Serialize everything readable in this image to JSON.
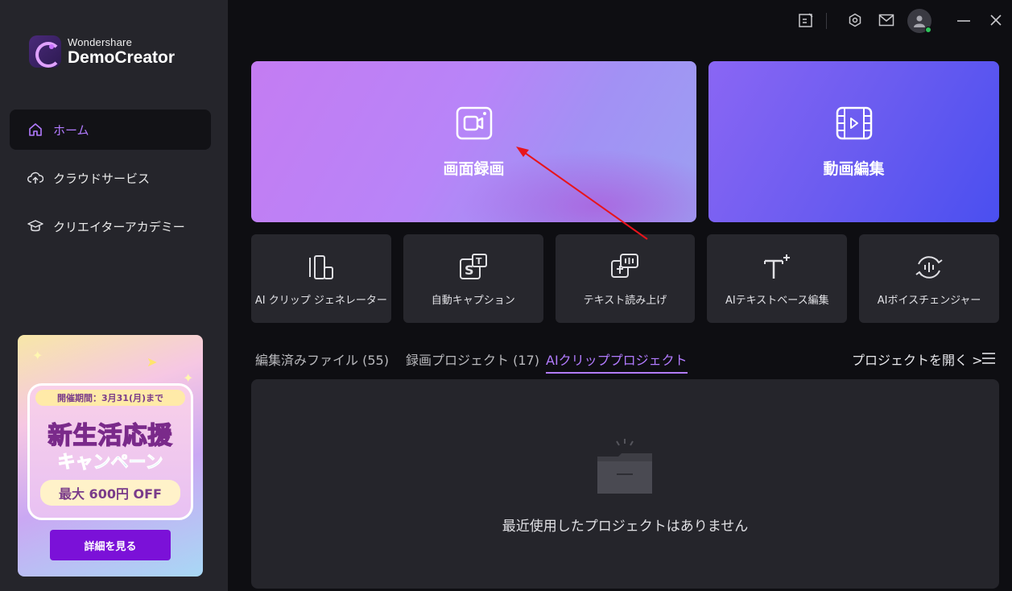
{
  "app": {
    "brand_sub": "Wondershare",
    "brand_main": "DemoCreator"
  },
  "sidebar": {
    "items": [
      {
        "label": "ホーム",
        "icon": "home-icon",
        "active": true
      },
      {
        "label": "クラウドサービス",
        "icon": "cloud-upload-icon",
        "active": false
      },
      {
        "label": "クリエイターアカデミー",
        "icon": "graduation-cap-icon",
        "active": false
      }
    ]
  },
  "promo": {
    "period": "開催期間：3月31(月)まで",
    "title": "新生活応援",
    "subtitle": "キャンペーン",
    "discount": "最大 600円 OFF",
    "button_label": "詳細を見る"
  },
  "topbar": {
    "icons": [
      "feedback-icon",
      "settings-hex-icon",
      "mail-icon",
      "user-avatar-icon",
      "minimize-icon",
      "close-icon"
    ]
  },
  "main": {
    "card_record_label": "画面録画",
    "card_edit_label": "動画編集",
    "tools": [
      {
        "label": "AI クリップ ジェネレーター",
        "icon": "ai-clip-icon"
      },
      {
        "label": "自動キャプション",
        "icon": "subtitle-icon"
      },
      {
        "label": "テキスト読み上げ",
        "icon": "text-to-speech-icon"
      },
      {
        "label": "AIテキストベース編集",
        "icon": "text-edit-icon"
      },
      {
        "label": "AIボイスチェンジャー",
        "icon": "voice-changer-icon"
      }
    ],
    "tabs": [
      {
        "label": "編集済みファイル (55)",
        "active": false
      },
      {
        "label": "録画プロジェクト (17)",
        "active": false
      },
      {
        "label": "AIクリッププロジェクト",
        "active": true
      }
    ],
    "open_project_label": "プロジェクトを開く >",
    "empty_text": "最近使用したプロジェクトはありません"
  },
  "colors": {
    "accent": "#b27bff",
    "sidebar_bg": "#25252b",
    "annotation_arrow": "#e8141c"
  }
}
